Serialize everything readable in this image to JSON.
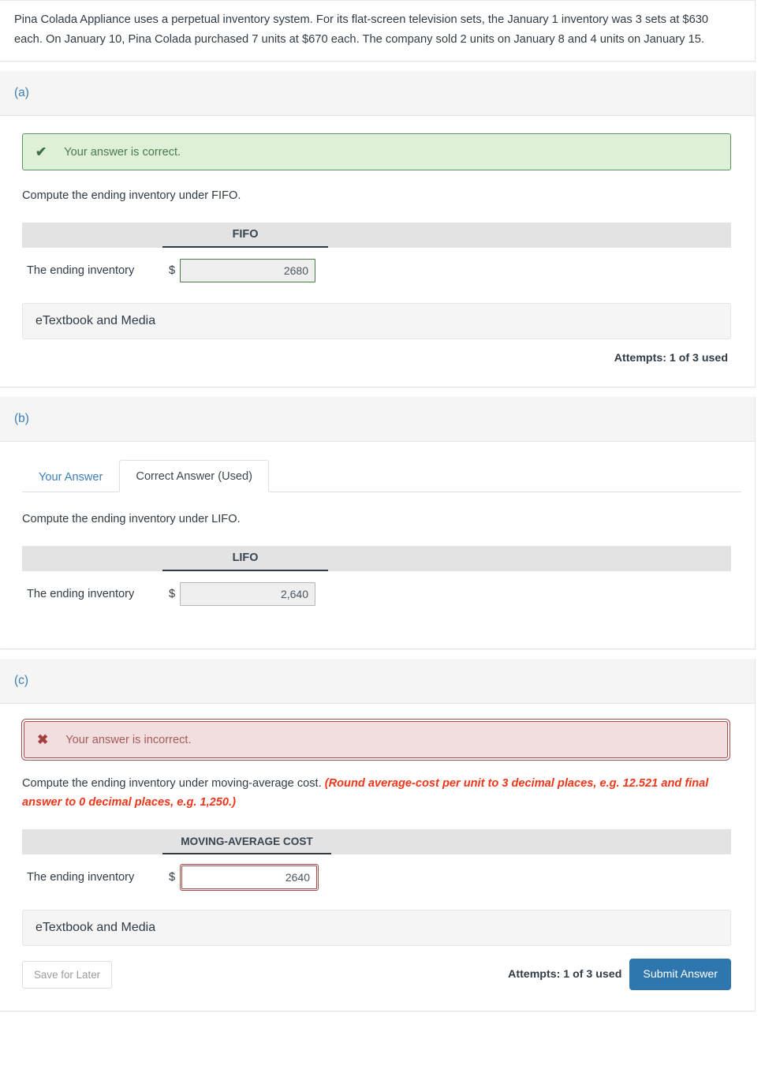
{
  "question": {
    "text": "Pina Colada Appliance uses a perpetual inventory system. For its flat-screen television sets, the January 1 inventory was 3 sets at $630 each. On January 10, Pina Colada purchased 7 units at $670 each. The company sold 2 units on January 8 and 4 units on January 15."
  },
  "colors": {
    "link_blue": "#3c7eb5",
    "submit_blue": "#2e76ae",
    "success_bg": "#dff0d8",
    "success_border": "#5c9460",
    "danger_bg": "#f2dede",
    "danger_border": "#a34a4a",
    "hint_red": "#f0361a"
  },
  "parts": [
    {
      "label": "(a)",
      "alert": {
        "icon": "checkmark-icon",
        "glyph": "✔",
        "message": "Your answer is correct.",
        "type": "success"
      },
      "prompt": "Compute the ending inventory under FIFO.",
      "hint": "",
      "table": {
        "column_header": "FIFO",
        "row_label": "The ending inventory",
        "currency_symbol": "$",
        "value": "2680",
        "state": "correct"
      },
      "etextbook_label": "eTextbook and Media",
      "attempts": "Attempts: 1 of 3 used"
    },
    {
      "label": "(b)",
      "tabs": [
        {
          "label": "Your Answer",
          "active": false
        },
        {
          "label": "Correct Answer (Used)",
          "active": true
        }
      ],
      "prompt": "Compute the ending inventory under LIFO.",
      "hint": "",
      "table": {
        "column_header": "LIFO",
        "row_label": "The ending inventory",
        "currency_symbol": "$",
        "value": "2,640",
        "state": "neutral"
      }
    },
    {
      "label": "(c)",
      "alert": {
        "icon": "cross-icon",
        "glyph": "✖",
        "message": "Your answer is incorrect.",
        "type": "danger"
      },
      "prompt": "Compute the ending inventory under moving-average cost.",
      "hint": "(Round average-cost per unit to 3 decimal places, e.g. 12.521 and final answer to 0 decimal places, e.g. 1,250.)",
      "table": {
        "column_header": "MOVING-AVERAGE COST",
        "row_label": "The ending inventory",
        "currency_symbol": "$",
        "value": "2640",
        "state": "incorrect"
      },
      "etextbook_label": "eTextbook and Media",
      "footer": {
        "save_label": "Save for Later",
        "attempts": "Attempts: 1 of 3 used",
        "submit_label": "Submit Answer"
      }
    }
  ]
}
